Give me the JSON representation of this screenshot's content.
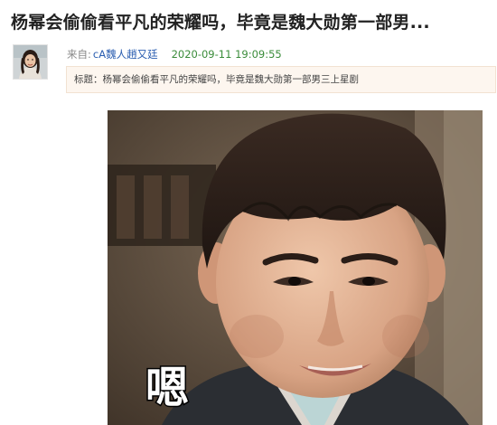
{
  "article": {
    "headline": "杨幂会偷偷看平凡的荣耀吗，毕竟是魏大勋第一部男...",
    "from_label": "来自:",
    "author": "cA魏人趙又廷",
    "datetime": "2020-09-11 19:09:55",
    "title_line": "标题：杨幂会偷偷看平凡的荣耀吗，毕竟是魏大勋第一部男三上星剧"
  },
  "image": {
    "subtitle_text": "嗯"
  },
  "colors": {
    "author_link": "#2a5db0",
    "datetime": "#3a8c3a",
    "title_box_bg": "#fdf6ef",
    "title_box_border": "#f2e2d2"
  }
}
